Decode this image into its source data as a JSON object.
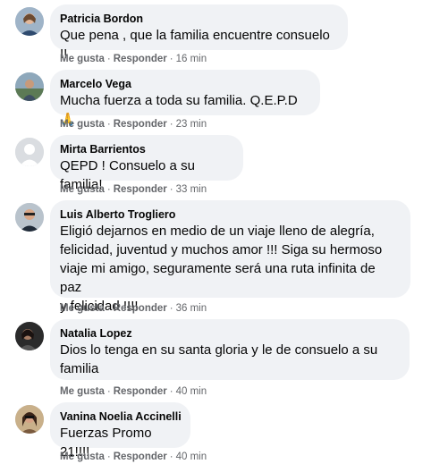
{
  "comments": [
    {
      "author": "Patricia Bordon",
      "text": "Que pena , que la familia encuentre consuelo !!",
      "like": "Me gusta",
      "reply": "Responder",
      "time": "16 min"
    },
    {
      "author": "Marcelo Vega",
      "text": "Mucha fuerza a toda su familia. Q.E.P.D",
      "emoji": "🙏",
      "like": "Me gusta",
      "reply": "Responder",
      "time": "23 min"
    },
    {
      "author": "Mirta Barrientos",
      "text": "QEPD ! Consuelo a su familia!",
      "like": "Me gusta",
      "reply": "Responder",
      "time": "33 min"
    },
    {
      "author": "Luis Alberto Trogliero",
      "lines": [
        "Eligió dejarnos en medio de un viaje lleno de alegría,",
        "felicidad, juventud y muchos amor !!! Siga su hermoso",
        "viaje mi amigo, seguramente será una ruta infinita de paz",
        "y felicidad !!!!"
      ],
      "like": "Me gusta",
      "reply": "Responder",
      "time": "36 min"
    },
    {
      "author": "Natalia Lopez",
      "lines": [
        "Dios lo tenga en su santa gloria y le de consuelo a su",
        "familia"
      ],
      "like": "Me gusta",
      "reply": "Responder",
      "time": "40 min"
    },
    {
      "author": "Vanina Noelia Accinelli",
      "text": "Fuerzas Promo 21!!!!",
      "like": "Me gusta",
      "reply": "Responder",
      "time": "40 min"
    }
  ],
  "separator": "·"
}
